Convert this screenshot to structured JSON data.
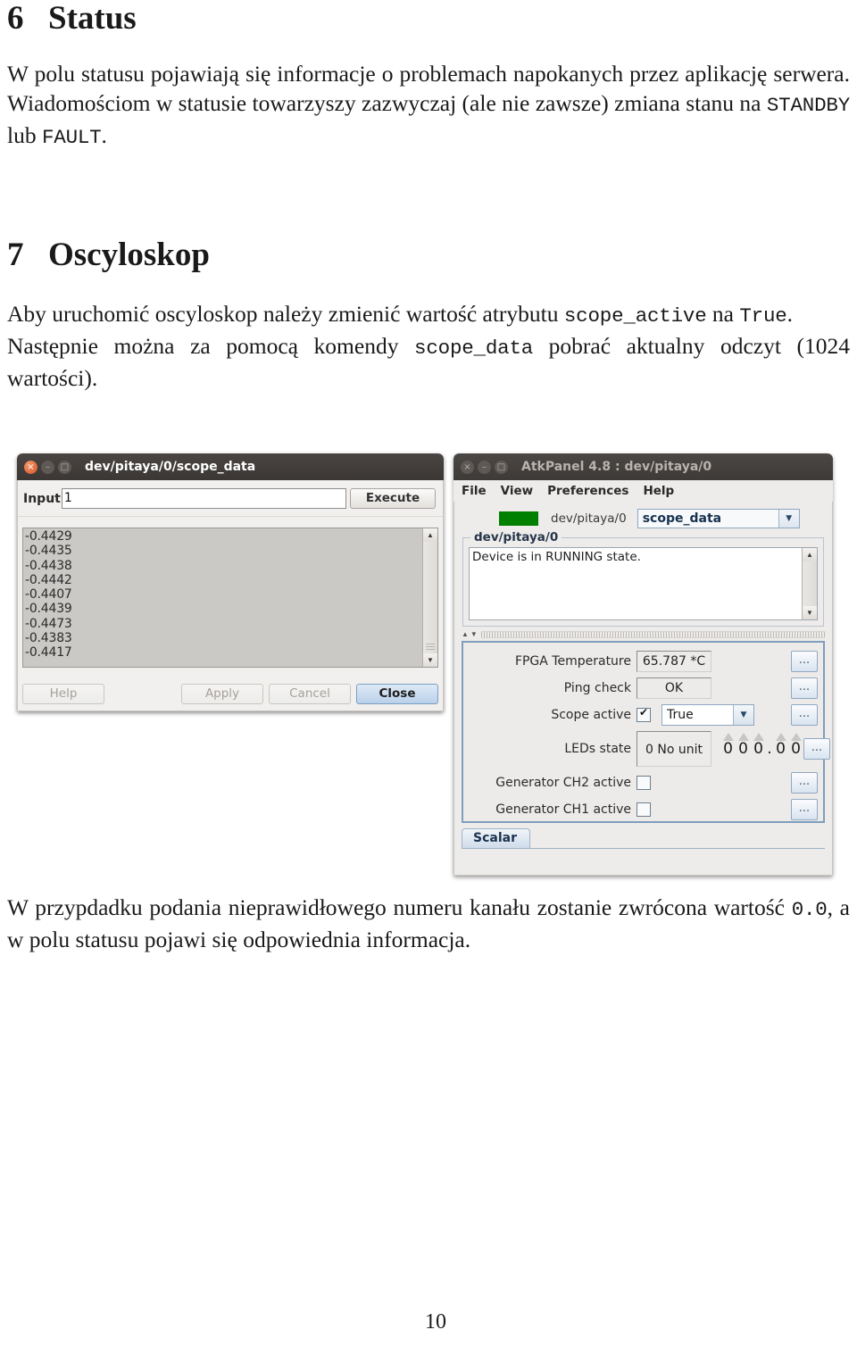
{
  "document": {
    "section6": {
      "number": "6",
      "title": "Status",
      "paragraph_pre": "W polu statusu pojawiają się informacje o problemach napokanych przez aplikację serwera. Wiadomościom w statusie towarzyszy zazwyczaj (ale nie zawsze) zmiana stanu na ",
      "code1": "STANDBY",
      "paragraph_mid": " lub ",
      "code2": "FAULT",
      "paragraph_post": "."
    },
    "section7": {
      "number": "7",
      "title": "Oscyloskop",
      "p1_pre": "Aby uruchomić oscyloskop należy zmienić wartość atrybutu ",
      "p1_code1": "scope_active",
      "p1_mid": " na ",
      "p1_code2": "True",
      "p1_post": ".",
      "p2_pre": "Następnie można za pomocą komendy ",
      "p2_code": "scope_data",
      "p2_post": " pobrać aktualny odczyt (1024 wartości)."
    },
    "closing": {
      "pre": "W przypdadku podania nieprawidłowego numeru kanału zostanie zwrócona wartość ",
      "code": "0.0",
      "post": ", a w polu statusu pojawi się odpowiednia informacja."
    },
    "page_number": "10"
  },
  "left_window": {
    "title": "dev/pitaya/0/scope_data",
    "titlebar_buttons": {
      "close": "×",
      "minimize": "–",
      "maximize": "□"
    },
    "input": {
      "label": "Input",
      "value": "1",
      "placeholder": ""
    },
    "execute_label": "Execute",
    "values": [
      "-0.4429",
      "-0.4435",
      "-0.4438",
      "-0.4442",
      "-0.4407",
      "-0.4439",
      "-0.4473",
      "-0.4383",
      "-0.4417"
    ],
    "scroll": {
      "up": "▲",
      "down": "▼"
    },
    "buttons": {
      "help": "Help",
      "apply": "Apply",
      "cancel": "Cancel",
      "close": "Close"
    }
  },
  "right_window": {
    "title": "AtkPanel 4.8 : dev/pitaya/0",
    "titlebar_buttons": {
      "close": "×",
      "minimize": "–",
      "maximize": "□"
    },
    "menu": [
      "File",
      "View",
      "Preferences",
      "Help"
    ],
    "device_selector": {
      "status_color": "#008000",
      "device": "dev/pitaya/0",
      "selected_attribute": "scope_data",
      "arrow": "▼"
    },
    "status_group": {
      "title": "dev/pitaya/0",
      "message": "Device is in RUNNING state.",
      "scroll_up": "▲",
      "scroll_down": "▼"
    },
    "attributes": [
      {
        "label": "FPGA Temperature",
        "value": "65.787 *C",
        "dots": "..."
      },
      {
        "label": "Ping check",
        "value": "OK",
        "dots": "..."
      },
      {
        "label": "Scope active",
        "checkbox": true,
        "combo_value": "True",
        "combo_arrow": "▼",
        "dots": "..."
      },
      {
        "label": "LEDs state",
        "value": "0 No unit",
        "spinner": "000.00",
        "dots": "..."
      },
      {
        "label": "Generator CH2 active",
        "checkbox": false,
        "dots": "..."
      },
      {
        "label": "Generator CH1 active",
        "checkbox": false,
        "dots": "..."
      }
    ],
    "tab": "Scalar"
  }
}
